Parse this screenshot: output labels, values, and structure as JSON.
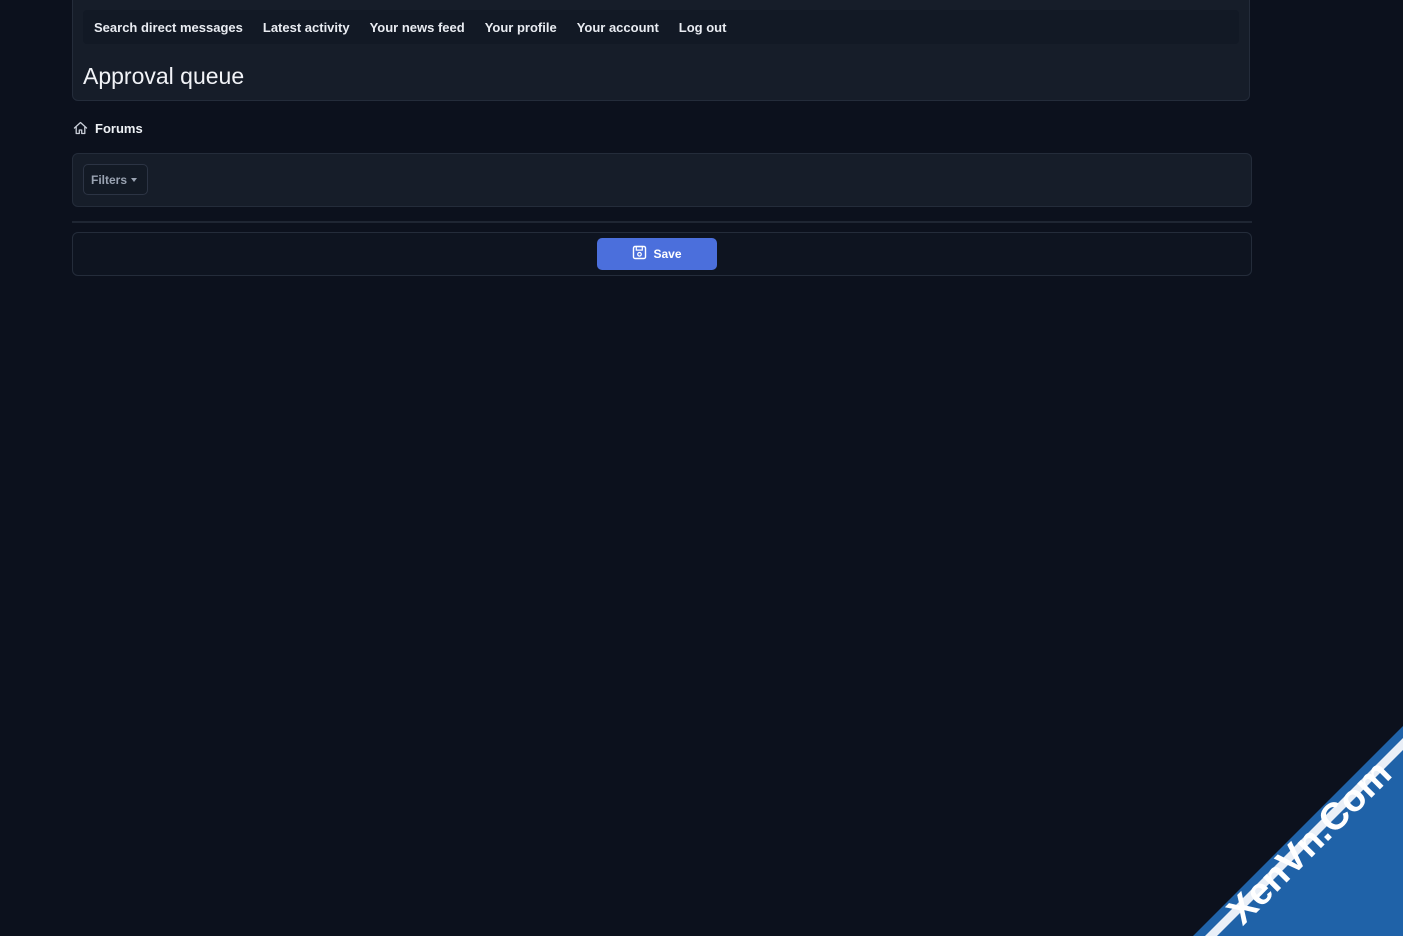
{
  "nav": {
    "items": [
      {
        "label": "Search direct messages"
      },
      {
        "label": "Latest activity"
      },
      {
        "label": "Your news feed"
      },
      {
        "label": "Your profile"
      },
      {
        "label": "Your account"
      },
      {
        "label": "Log out"
      }
    ]
  },
  "header": {
    "title": "Approval queue"
  },
  "breadcrumb": {
    "label": "Forums",
    "icon": "home-icon"
  },
  "filters": {
    "label": "Filters",
    "icon": "chevron-down-icon"
  },
  "actions": {
    "save_label": "Save",
    "save_icon": "save-icon",
    "save_color": "#4b6fdc"
  },
  "watermark": {
    "text": "XenVn.Com"
  }
}
